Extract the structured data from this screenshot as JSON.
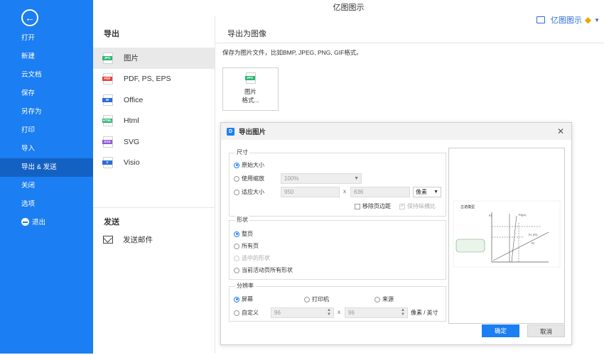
{
  "window": {
    "title": "亿图图示"
  },
  "topbar": {
    "brand_label": "亿图图示"
  },
  "sidebar": {
    "items": [
      {
        "label": "打开"
      },
      {
        "label": "新建"
      },
      {
        "label": "云文档"
      },
      {
        "label": "保存"
      },
      {
        "label": "另存为"
      },
      {
        "label": "打印"
      },
      {
        "label": "导入"
      },
      {
        "label": "导出 & 发送",
        "active": true
      },
      {
        "label": "关闭"
      },
      {
        "label": "选项"
      },
      {
        "label": "退出"
      }
    ]
  },
  "export_panel": {
    "title": "导出",
    "formats": [
      {
        "label": "图片",
        "tag": "JPG",
        "color": "#2bb673"
      },
      {
        "label": "PDF, PS, EPS",
        "tag": "PDF",
        "color": "#e8413b"
      },
      {
        "label": "Office",
        "tag": "W",
        "color": "#2b6fd6"
      },
      {
        "label": "Html",
        "tag": "HTML",
        "color": "#2bb673"
      },
      {
        "label": "SVG",
        "tag": "SVG",
        "color": "#8e5bd6"
      },
      {
        "label": "Visio",
        "tag": "V",
        "color": "#2b6fd6"
      }
    ],
    "send_title": "发送",
    "send_mail": "发送邮件"
  },
  "content": {
    "heading": "导出为图像",
    "description": "保存为图片文件，比如BMP, JPEG, PNG, GIF格式。",
    "tile_tag": "JPG",
    "tile_line1": "图片",
    "tile_line2": "格式..."
  },
  "dialog": {
    "title": "导出图片",
    "logo": "D",
    "size": {
      "title": "尺寸",
      "original": "原始大小",
      "zoom": "使用缩放",
      "zoom_value": "100%",
      "fit": "适应大小",
      "width": "950",
      "times": "x",
      "height": "636",
      "unit": "像素",
      "remove_margin": "移除页边距",
      "keep_ratio": "保持纵横比"
    },
    "shape": {
      "title": "形状",
      "whole_page": "整页",
      "all_pages": "所有页",
      "selected_shapes": "选中的形状",
      "current_page_shapes": "当前活动页所有形状"
    },
    "resolution": {
      "title": "分辨率",
      "screen": "屏幕",
      "printer": "打印机",
      "source": "来源",
      "custom": "自定义",
      "x_value": "96",
      "times": "x",
      "y_value": "96",
      "unit": "像素 / 英寸"
    },
    "ok": "确定",
    "cancel": "取消"
  },
  "preview_chart": {
    "title": "古诺模型",
    "labels": [
      "P1",
      "P2(p1)",
      "P1' (P2)",
      "P2"
    ]
  }
}
